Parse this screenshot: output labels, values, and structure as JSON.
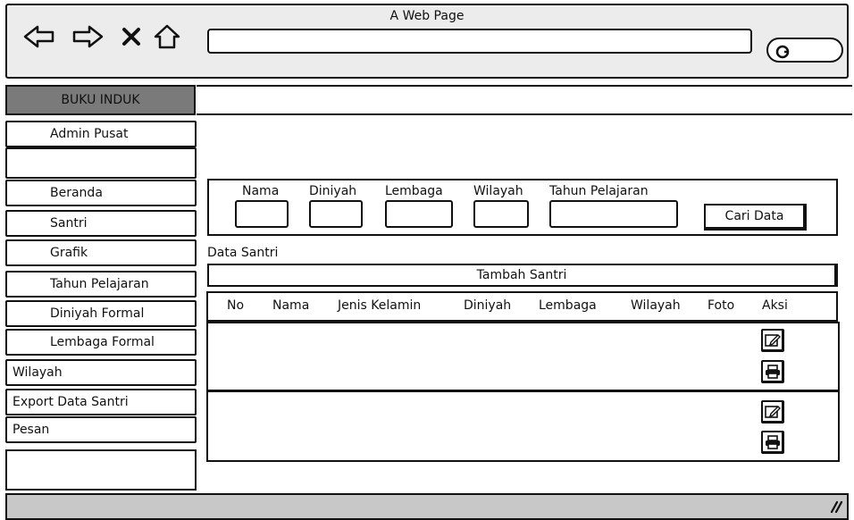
{
  "window": {
    "title": "A Web Page"
  },
  "browser": {
    "back_icon": "back-arrow-icon",
    "forward_icon": "forward-arrow-icon",
    "stop_icon": "close-icon",
    "home_icon": "home-icon",
    "search_icon": "search-icon",
    "url_value": ""
  },
  "sidebar": {
    "header": "BUKU INDUK",
    "items": [
      {
        "label": "Admin Pusat"
      },
      {
        "label": ""
      },
      {
        "label": "Beranda"
      },
      {
        "label": "Santri"
      },
      {
        "label": "Grafik"
      },
      {
        "label": "Tahun Pelajaran"
      },
      {
        "label": "Diniyah Formal"
      },
      {
        "label": "Lembaga Formal"
      },
      {
        "label": "Wilayah"
      },
      {
        "label": "Export Data Santri"
      },
      {
        "label": "Pesan"
      }
    ]
  },
  "filters": {
    "labels": [
      "Nama",
      "Diniyah",
      "Lembaga",
      "Wilayah",
      "Tahun Pelajaran"
    ],
    "button": "Cari Data"
  },
  "data": {
    "section_label": "Data Santri",
    "add_button": "Tambah Santri",
    "columns": [
      "No",
      "Nama",
      "Jenis Kelamin",
      "Diniyah",
      "Lembaga",
      "Wilayah",
      "Foto",
      "Aksi"
    ],
    "row_actions": [
      "edit-icon",
      "print-icon"
    ]
  }
}
